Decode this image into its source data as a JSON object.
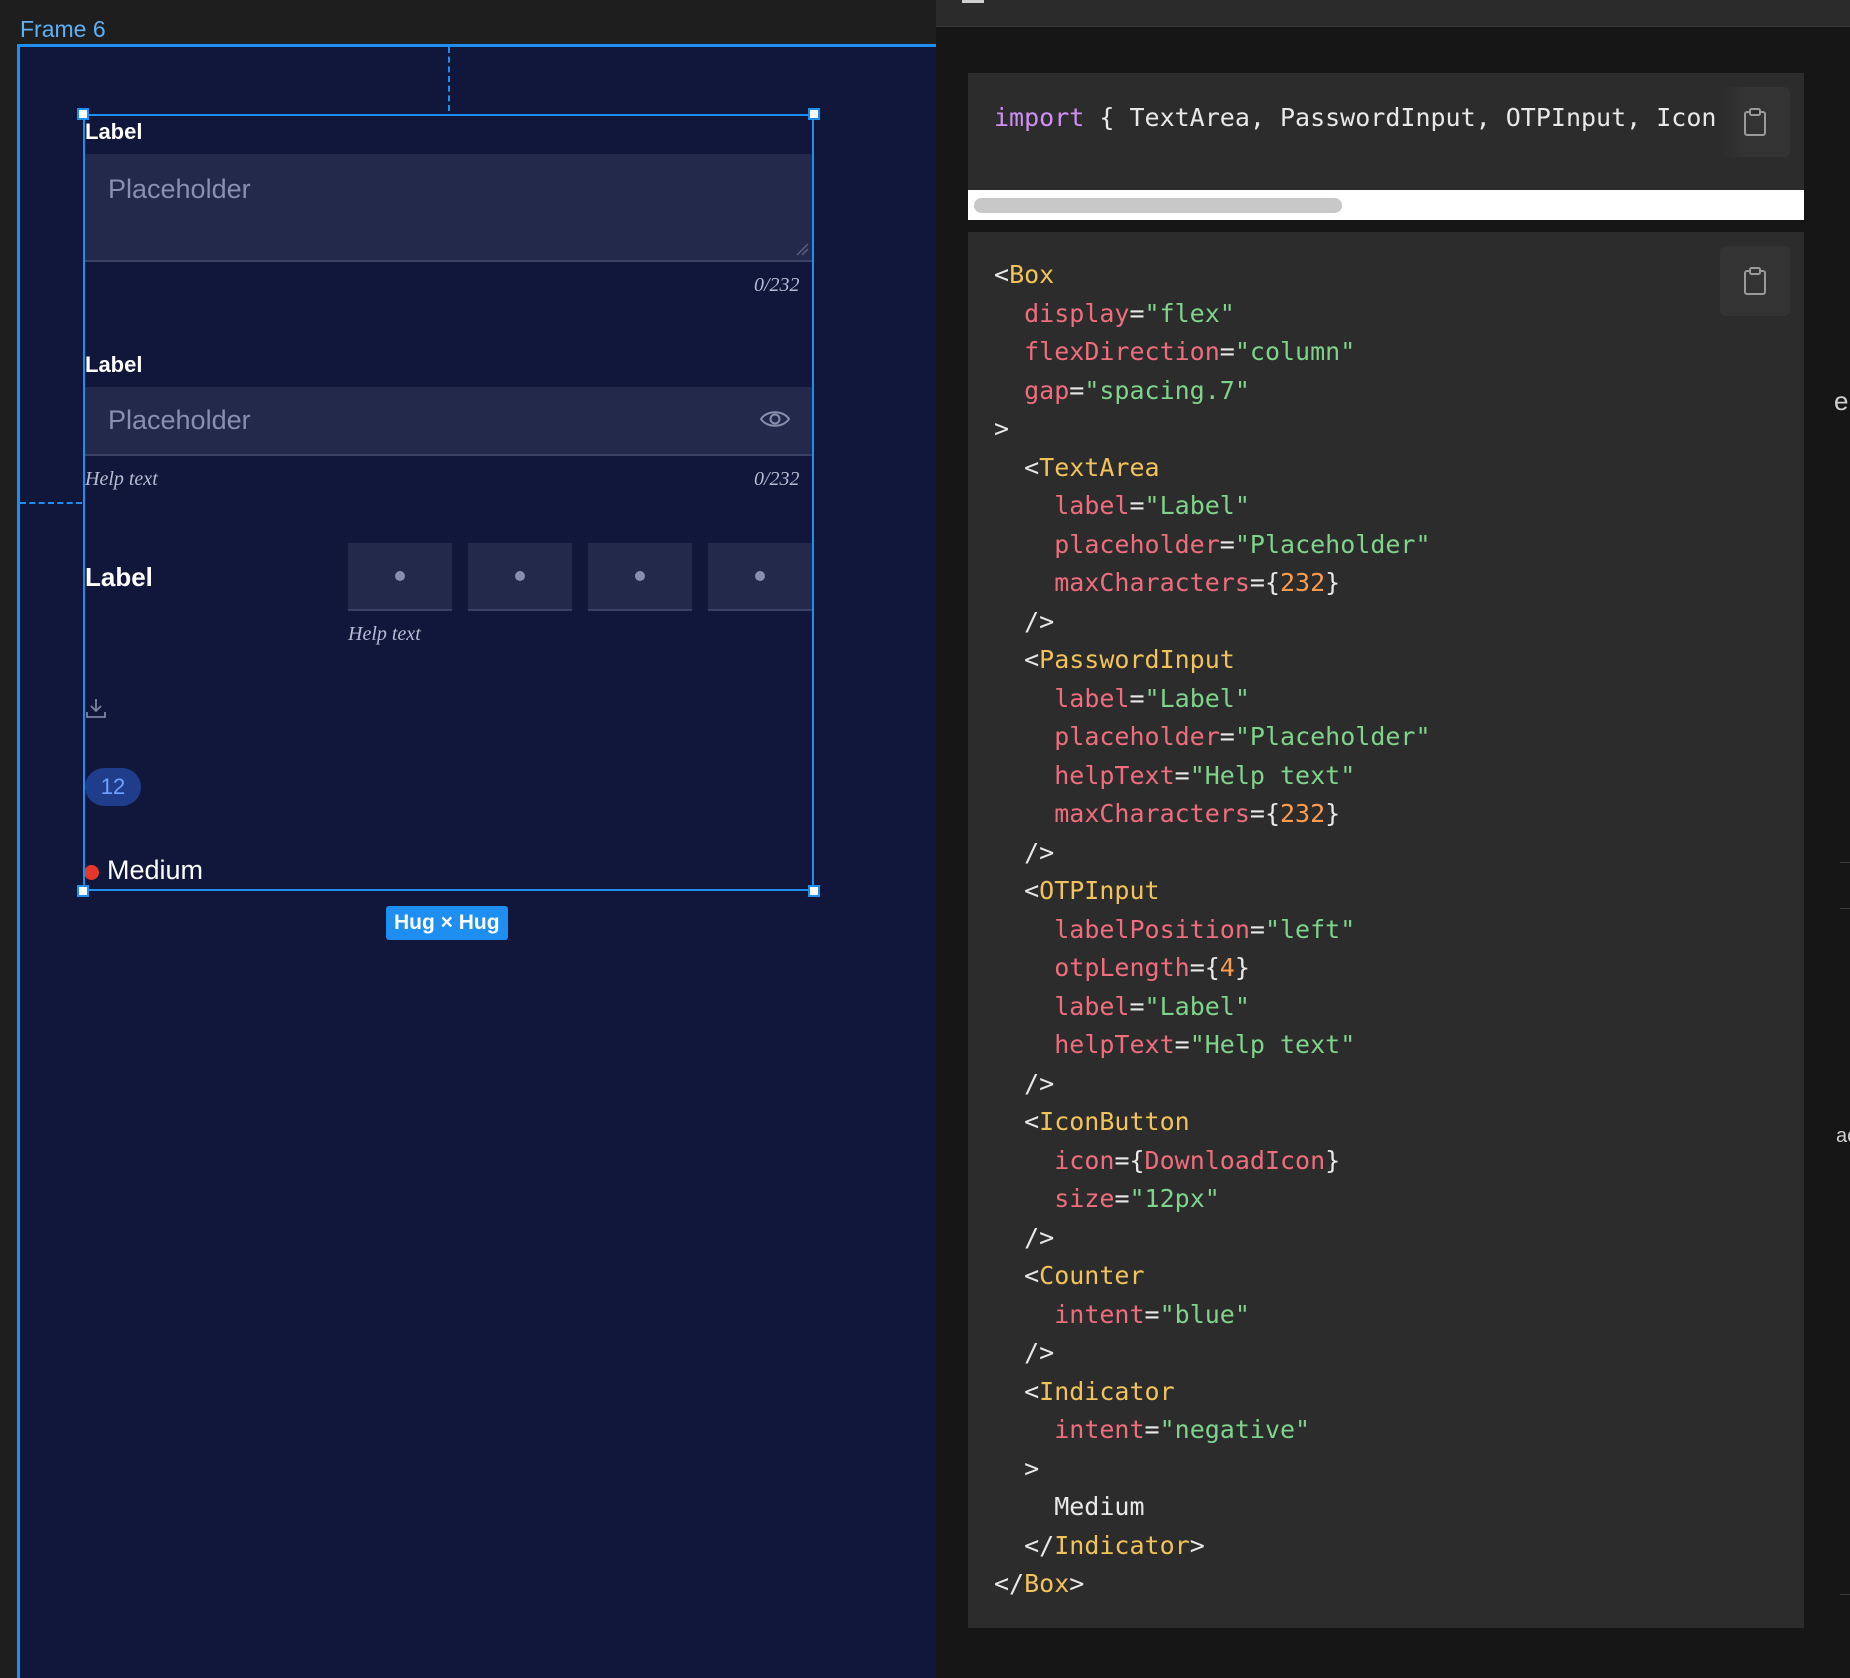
{
  "canvas": {
    "frame_title": "Frame 6",
    "text_area": {
      "label": "Label",
      "placeholder": "Placeholder",
      "char_count": "0/232"
    },
    "password_input": {
      "label": "Label",
      "placeholder": "Placeholder",
      "help_text": "Help text",
      "char_count": "0/232"
    },
    "otp_input": {
      "label": "Label",
      "help_text": "Help text",
      "length": 4
    },
    "counter": {
      "value": "12"
    },
    "indicator": {
      "label": "Medium",
      "color": "#e5372a"
    },
    "selection_badge": "Hug × Hug"
  },
  "code_panel": {
    "import_line": "import { TextArea, PasswordInput, OTPInput, Icon",
    "edge_glyphs": [
      "e",
      "ac"
    ],
    "colors": {
      "tag": "#f2c35b",
      "attr": "#ef6d7d",
      "string": "#7fd48b",
      "number": "#ff9b4d",
      "keyword": "#d08ff2"
    },
    "jsx_lines": [
      [
        [
          "p",
          "<"
        ],
        [
          "t",
          "Box"
        ]
      ],
      [
        [
          "p",
          "  "
        ],
        [
          "a",
          "display"
        ],
        [
          "p",
          "="
        ],
        [
          "s",
          "\"flex\""
        ]
      ],
      [
        [
          "p",
          "  "
        ],
        [
          "a",
          "flexDirection"
        ],
        [
          "p",
          "="
        ],
        [
          "s",
          "\"column\""
        ]
      ],
      [
        [
          "p",
          "  "
        ],
        [
          "a",
          "gap"
        ],
        [
          "p",
          "="
        ],
        [
          "s",
          "\"spacing.7\""
        ]
      ],
      [
        [
          "p",
          ">"
        ]
      ],
      [
        [
          "p",
          "  <"
        ],
        [
          "t",
          "TextArea"
        ]
      ],
      [
        [
          "p",
          "    "
        ],
        [
          "a",
          "label"
        ],
        [
          "p",
          "="
        ],
        [
          "s",
          "\"Label\""
        ]
      ],
      [
        [
          "p",
          "    "
        ],
        [
          "a",
          "placeholder"
        ],
        [
          "p",
          "="
        ],
        [
          "s",
          "\"Placeholder\""
        ]
      ],
      [
        [
          "p",
          "    "
        ],
        [
          "a",
          "maxCharacters"
        ],
        [
          "p",
          "={"
        ],
        [
          "n",
          "232"
        ],
        [
          "p",
          "}"
        ]
      ],
      [
        [
          "p",
          "  />"
        ]
      ],
      [
        [
          "p",
          "  <"
        ],
        [
          "t",
          "PasswordInput"
        ]
      ],
      [
        [
          "p",
          "    "
        ],
        [
          "a",
          "label"
        ],
        [
          "p",
          "="
        ],
        [
          "s",
          "\"Label\""
        ]
      ],
      [
        [
          "p",
          "    "
        ],
        [
          "a",
          "placeholder"
        ],
        [
          "p",
          "="
        ],
        [
          "s",
          "\"Placeholder\""
        ]
      ],
      [
        [
          "p",
          "    "
        ],
        [
          "a",
          "helpText"
        ],
        [
          "p",
          "="
        ],
        [
          "s",
          "\"Help text\""
        ]
      ],
      [
        [
          "p",
          "    "
        ],
        [
          "a",
          "maxCharacters"
        ],
        [
          "p",
          "={"
        ],
        [
          "n",
          "232"
        ],
        [
          "p",
          "}"
        ]
      ],
      [
        [
          "p",
          "  />"
        ]
      ],
      [
        [
          "p",
          "  <"
        ],
        [
          "t",
          "OTPInput"
        ]
      ],
      [
        [
          "p",
          "    "
        ],
        [
          "a",
          "labelPosition"
        ],
        [
          "p",
          "="
        ],
        [
          "s",
          "\"left\""
        ]
      ],
      [
        [
          "p",
          "    "
        ],
        [
          "a",
          "otpLength"
        ],
        [
          "p",
          "={"
        ],
        [
          "n",
          "4"
        ],
        [
          "p",
          "}"
        ]
      ],
      [
        [
          "p",
          "    "
        ],
        [
          "a",
          "label"
        ],
        [
          "p",
          "="
        ],
        [
          "s",
          "\"Label\""
        ]
      ],
      [
        [
          "p",
          "    "
        ],
        [
          "a",
          "helpText"
        ],
        [
          "p",
          "="
        ],
        [
          "s",
          "\"Help text\""
        ]
      ],
      [
        [
          "p",
          "  />"
        ]
      ],
      [
        [
          "p",
          "  <"
        ],
        [
          "t",
          "IconButton"
        ]
      ],
      [
        [
          "p",
          "    "
        ],
        [
          "a",
          "icon"
        ],
        [
          "p",
          "={"
        ],
        [
          "e",
          "DownloadIcon"
        ],
        [
          "p",
          "}"
        ]
      ],
      [
        [
          "p",
          "    "
        ],
        [
          "a",
          "size"
        ],
        [
          "p",
          "="
        ],
        [
          "s",
          "\"12px\""
        ]
      ],
      [
        [
          "p",
          "  />"
        ]
      ],
      [
        [
          "p",
          "  <"
        ],
        [
          "t",
          "Counter"
        ]
      ],
      [
        [
          "p",
          "    "
        ],
        [
          "a",
          "intent"
        ],
        [
          "p",
          "="
        ],
        [
          "s",
          "\"blue\""
        ]
      ],
      [
        [
          "p",
          "  />"
        ]
      ],
      [
        [
          "p",
          "  <"
        ],
        [
          "t",
          "Indicator"
        ]
      ],
      [
        [
          "p",
          "    "
        ],
        [
          "a",
          "intent"
        ],
        [
          "p",
          "="
        ],
        [
          "s",
          "\"negative\""
        ]
      ],
      [
        [
          "p",
          "  >"
        ]
      ],
      [
        [
          "p",
          "    Medium"
        ]
      ],
      [
        [
          "p",
          "  </"
        ],
        [
          "t",
          "Indicator"
        ],
        [
          "p",
          ">"
        ]
      ],
      [
        [
          "p",
          "</"
        ],
        [
          "t",
          "Box"
        ],
        [
          "p",
          ">"
        ]
      ]
    ]
  }
}
